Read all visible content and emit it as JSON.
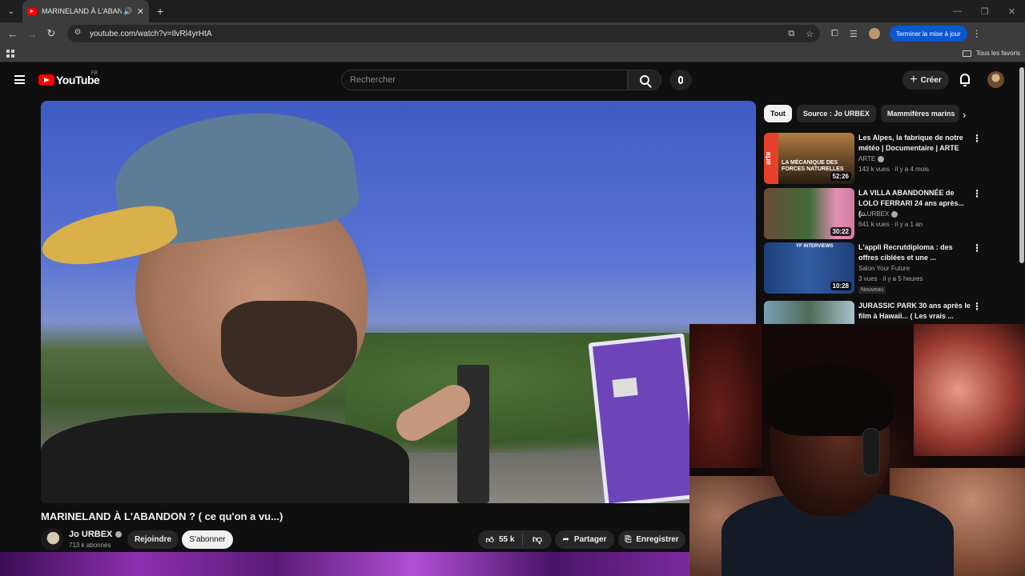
{
  "browser": {
    "tab_title": "MARINELAND À L'ABANDON",
    "url": "youtube.com/watch?v=IlvRl4yrHtA",
    "update_button": "Terminer la mise à jour",
    "bookmarks_all": "Tous les favoris"
  },
  "youtube": {
    "logo_text": "YouTube",
    "country": "FR",
    "search_placeholder": "Rechercher",
    "create_label": "Créer"
  },
  "video": {
    "title": "MARINELAND À L'ABANDON ? ( ce qu'on a vu...)",
    "channel": "Jo URBEX",
    "subscribers": "713 k abonnés",
    "join_label": "Rejoindre",
    "subscribe_label": "S'abonner",
    "likes": "55 k",
    "share_label": "Partager",
    "save_label": "Enregistrer"
  },
  "chips": [
    "Tout",
    "Source : Jo URBEX",
    "Mammifères marins"
  ],
  "recommendations": [
    {
      "title": "Les Alpes, la fabrique de notre météo | Documentaire | ARTE",
      "channel": "ARTE",
      "meta": "143 k vues · il y a 4 mois",
      "duration": "52:26",
      "thumb_text": "LA MÉCANIQUE DES FORCES NATURELLES",
      "thumb_brand": "arte"
    },
    {
      "title": "LA VILLA ABANDONNÉE de LOLO FERRARI 24 ans après...(...",
      "channel": "Jo URBEX",
      "meta": "641 k vues · il y a 1 an",
      "duration": "30:22"
    },
    {
      "title": "L'appli Recrutdiploma : des offres ciblées et une ...",
      "channel": "Salon Your Future",
      "meta": "3 vues · il y a 5 heures",
      "duration": "10:28",
      "badge": "Nouveau",
      "thumb_text": "YF INTERVIEWS"
    },
    {
      "title": "JURASSIC PARK 30 ans après le film à Hawaii... ( Les vrais ...",
      "channel": "",
      "meta": "",
      "duration": ""
    }
  ],
  "colors": {
    "background": "#0f0f0f",
    "youtube_red": "#ff0000",
    "chrome_blue": "#0b57d0"
  }
}
